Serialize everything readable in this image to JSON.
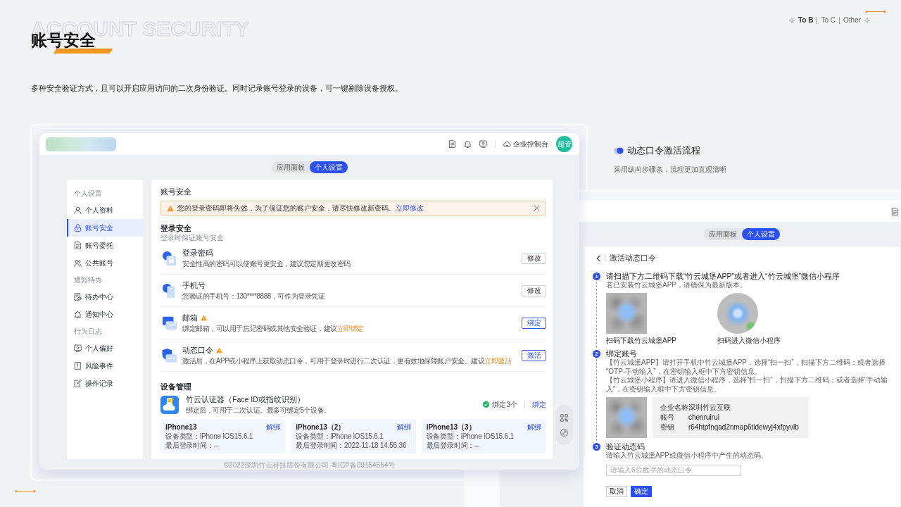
{
  "header": {
    "background_title": "ACCOUNT SECURITY",
    "title": "账号安全",
    "description": "多种安全验证方式，且可以开启应用访问的二次身份验证。同时记录账号登录的设备，可一键剔除设备授权。"
  },
  "audience_tabs": [
    {
      "label": "To B",
      "selected": true
    },
    {
      "label": "To C",
      "selected": false
    },
    {
      "label": "Other",
      "selected": false
    }
  ],
  "app_preview": {
    "topbar": {
      "console_label": "企业控制台",
      "avatar": "超管"
    },
    "switch": [
      {
        "label": "应用面板",
        "selected": false
      },
      {
        "label": "个人设置",
        "selected": true
      }
    ],
    "sidebar": [
      {
        "group": "个人设置",
        "items": [
          {
            "label": "个人资料",
            "selected": false
          },
          {
            "label": "账号安全",
            "selected": true
          },
          {
            "label": "账号委托",
            "selected": false
          },
          {
            "label": "公共账号",
            "selected": false
          }
        ]
      },
      {
        "group": "通知待办",
        "items": [
          {
            "label": "待办中心",
            "selected": false
          },
          {
            "label": "通知中心",
            "selected": false
          }
        ]
      },
      {
        "group": "行为日志",
        "items": [
          {
            "label": "个人偏好",
            "selected": false
          },
          {
            "label": "风险事件",
            "selected": false
          },
          {
            "label": "操作记录",
            "selected": false
          }
        ]
      }
    ],
    "page_title": "账号安全",
    "alert": {
      "text": "您的登录密码即将失效，为了保证您的账户安全，请尽快修改新密码。",
      "link": "立即修改"
    },
    "login_security": {
      "title": "登录安全",
      "subtitle": "登录时保证账号安全",
      "items": [
        {
          "title": "登录密码",
          "warning": false,
          "description": "安全性高的密码可以使账号更安全，建议您定期更改密码",
          "button": {
            "label": "修改",
            "kind": "default"
          }
        },
        {
          "title": "手机号",
          "warning": false,
          "description": "您验证的手机号：130****8888，可作为登录凭证",
          "button": {
            "label": "修改",
            "kind": "default"
          }
        },
        {
          "title": "邮箱",
          "warning": true,
          "description": "绑定邮箱，可以用于忘记密码或其他安全验证，建议",
          "link": "立即绑定",
          "button": {
            "label": "绑定",
            "kind": "primary"
          }
        },
        {
          "title": "动态口令",
          "warning": true,
          "description": "激活后，在APP或小程序上获取动态口令，可用于登录时进行二次认证，更有效地保障账户安全。建议",
          "link": "立即激活",
          "button": {
            "label": "激活",
            "kind": "primary"
          }
        }
      ]
    },
    "device_management": {
      "title": "设备管理",
      "authenticator": {
        "title": "竹云认证器（Face ID或指纹识别）",
        "description": "绑定后，可用于二次认证。最多可绑定5个设备。",
        "status": "绑定3个",
        "action": "绑定"
      },
      "devices": [
        {
          "name": "iPhone13",
          "action": "解绑",
          "type": "设备类型：iPhone iOS15.6.1",
          "last_login": "最后登录时间：--"
        },
        {
          "name": "iPhone13（2）",
          "action": "解绑",
          "type": "设备类型：iPhone iOS15.6.1",
          "last_login": "最后登录时间：2022-11-18 14:55:36"
        },
        {
          "name": "iPhone13（3）",
          "action": "解绑",
          "type": "设备类型：iPhone iOS15.6.1",
          "last_login": "最后登录时间：--"
        }
      ]
    },
    "footer": "©2022深圳竹云科技股份有限公司 粤ICP备09154564号"
  },
  "activation_flow": {
    "title": "动态口令激活流程",
    "subtitle": "采用纵向步骤条，流程更加直观清晰",
    "switch": [
      {
        "label": "应用面板",
        "selected": false
      },
      {
        "label": "个人设置",
        "selected": true
      }
    ],
    "page_title": "激活动态口令",
    "steps": [
      {
        "number": "1",
        "title": "请扫描下方二维码下载“竹云城堡APP”或者进入“竹云城堡”微信小程序",
        "description": "若已安装竹云城堡APP，请确保为最新版本。",
        "codes": [
          {
            "kind": "qr",
            "caption": "扫码下载竹云城堡APP"
          },
          {
            "kind": "mini_program",
            "caption": "扫码进入微信小程序"
          }
        ]
      },
      {
        "number": "2",
        "title": "绑定账号",
        "lines": [
          "【竹云城堡APP】请打开手机中竹云城堡APP，选择“扫一扫”，扫描下方二维码；或者选择“OTP-手动输入”，在密钥输入框中下方密钥信息。",
          "【竹云城堡小程序】请进入微信小程序，选择“扫一扫”，扫描下方二维码；或者选择“手动输入”，在密钥输入框中下方密钥信息。"
        ],
        "codes": [
          {
            "kind": "qr"
          }
        ],
        "account_info": [
          {
            "label": "企业名称",
            "value": "深圳竹云互联"
          },
          {
            "label": "账号",
            "value": "chenruirui"
          },
          {
            "label": "密钥",
            "value": "r64htpfnqad2nmap6tidewyj4xfpyvlb"
          }
        ]
      },
      {
        "number": "3",
        "title": "验证动态码",
        "description": "请输入竹云城堡APP或微信小程序中产生的动态码。",
        "input": {
          "placeholder": "请输入6位数字的动态口令"
        }
      }
    ],
    "buttons": [
      {
        "label": "取消",
        "kind": "default"
      },
      {
        "label": "确定",
        "kind": "primary"
      }
    ]
  }
}
